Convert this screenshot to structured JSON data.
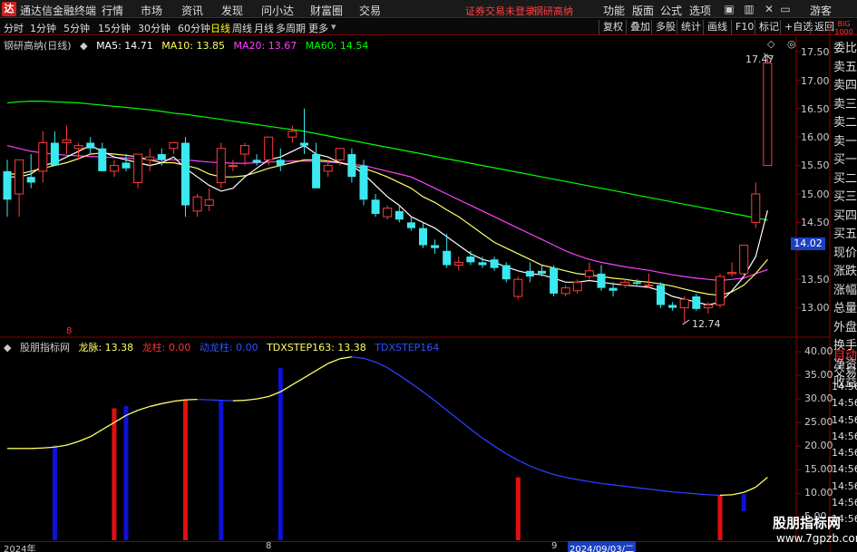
{
  "app": {
    "logo_char": "达",
    "title": "通达信金融终端",
    "menus": [
      "行情",
      "市场",
      "资讯",
      "发现",
      "问小达",
      "财富圈",
      "交易"
    ],
    "notice_login": "证券交易未登录",
    "notice_stock": "钢研高纳",
    "right_menus": [
      "功能",
      "版面",
      "公式",
      "选项"
    ],
    "guest": "游客"
  },
  "periods": {
    "items": [
      "分时",
      "1分钟",
      "5分钟",
      "15分钟",
      "30分钟",
      "60分钟",
      "日线",
      "周线",
      "月线",
      "多周期",
      "更多"
    ],
    "active_index": 6,
    "tools": [
      "复权",
      "叠加",
      "多股",
      "统计",
      "画线",
      "F10",
      "标记",
      "+自选",
      "返回"
    ]
  },
  "main_chart": {
    "stock_title": "钢研高纳(日线)",
    "ma5_label": "MA5: 14.71",
    "ma10_label": "MA10: 13.85",
    "ma20_label": "MA20: 13.67",
    "ma60_label": "MA60: 14.54",
    "high_label": "17.47",
    "low_label": "12.74",
    "current_price": "14.02",
    "y_ticks": [
      "17.50",
      "17.00",
      "16.50",
      "16.00",
      "15.50",
      "15.00",
      "14.50",
      "14.00",
      "13.50",
      "13.00"
    ],
    "colors": {
      "up": "#ff3c3c",
      "down": "#3ce8f0",
      "ma5": "#ffffff",
      "ma10": "#ffff66",
      "ma20": "#ff40ff",
      "ma60": "#00ff00"
    }
  },
  "indicator": {
    "name": "股朋指标网",
    "longmai_label": "龙脉: 13.38",
    "longzhu_label": "龙柱: 0.00",
    "dongzhu_label": "动龙柱: 0.00",
    "step163_label": "TDXSTEP163: 13.38",
    "step164_label": "TDXSTEP164",
    "marker": "8",
    "y_ticks": [
      "40.00",
      "35.00",
      "30.00",
      "25.00",
      "20.00",
      "15.00",
      "10.00",
      "5.00"
    ]
  },
  "right_panel": {
    "top_label": "BIG",
    "top_sub": "1000",
    "items": [
      "委比",
      "卖五",
      "卖四",
      "卖三",
      "卖二",
      "卖一",
      "买一",
      "买二",
      "买三",
      "买四",
      "买五",
      "现价",
      "涨跌",
      "涨幅",
      "总量",
      "外盘",
      "换手",
      "净资",
      "收益"
    ],
    "lower_items": [
      "自动",
      "交易"
    ],
    "times": [
      "14:56",
      "14:56",
      "14:56",
      "14:56",
      "14:56",
      "14:56",
      "14:56",
      "14:56",
      "14:56"
    ]
  },
  "bottom": {
    "year_label": "2024年",
    "month8": "8",
    "month9": "9",
    "date_label": "2024/09/03/二"
  },
  "watermark": {
    "line1": "股朋指标网",
    "line2": "www.7gpzb.com"
  },
  "chart_data": [
    {
      "type": "candlestick",
      "title": "钢研高纳(日线)",
      "ylim": [
        12.6,
        17.7
      ],
      "candles": [
        {
          "o": 15.4,
          "h": 15.6,
          "l": 14.6,
          "c": 14.9
        },
        {
          "o": 15.0,
          "h": 15.6,
          "l": 14.6,
          "c": 15.6
        },
        {
          "o": 15.3,
          "h": 15.7,
          "l": 15.1,
          "c": 15.2
        },
        {
          "o": 15.4,
          "h": 16.1,
          "l": 15.2,
          "c": 15.9
        },
        {
          "o": 15.9,
          "h": 16.1,
          "l": 15.6,
          "c": 15.5
        },
        {
          "o": 15.9,
          "h": 16.2,
          "l": 15.7,
          "c": 15.95
        },
        {
          "o": 15.8,
          "h": 15.9,
          "l": 15.6,
          "c": 15.85
        },
        {
          "o": 15.9,
          "h": 16.0,
          "l": 15.7,
          "c": 15.8
        },
        {
          "o": 15.8,
          "h": 15.9,
          "l": 15.4,
          "c": 15.4
        },
        {
          "o": 15.4,
          "h": 15.6,
          "l": 15.3,
          "c": 15.5
        },
        {
          "o": 15.55,
          "h": 15.7,
          "l": 15.4,
          "c": 15.45
        },
        {
          "o": 15.2,
          "h": 15.7,
          "l": 15.1,
          "c": 15.7
        },
        {
          "o": 15.6,
          "h": 15.8,
          "l": 15.4,
          "c": 15.65
        },
        {
          "o": 15.7,
          "h": 15.8,
          "l": 15.5,
          "c": 15.6
        },
        {
          "o": 15.8,
          "h": 15.9,
          "l": 15.7,
          "c": 15.9
        },
        {
          "o": 15.9,
          "h": 16.0,
          "l": 14.6,
          "c": 14.8
        },
        {
          "o": 14.7,
          "h": 15.0,
          "l": 14.6,
          "c": 14.95
        },
        {
          "o": 14.8,
          "h": 15.1,
          "l": 14.7,
          "c": 14.9
        },
        {
          "o": 15.2,
          "h": 15.9,
          "l": 15.1,
          "c": 15.8
        },
        {
          "o": 15.5,
          "h": 15.6,
          "l": 15.4,
          "c": 15.5
        },
        {
          "o": 15.7,
          "h": 15.9,
          "l": 15.5,
          "c": 15.85
        },
        {
          "o": 15.6,
          "h": 15.7,
          "l": 15.5,
          "c": 15.55
        },
        {
          "o": 15.6,
          "h": 16.0,
          "l": 15.5,
          "c": 16.0
        },
        {
          "o": 15.6,
          "h": 15.8,
          "l": 15.4,
          "c": 15.5
        },
        {
          "o": 16.0,
          "h": 16.2,
          "l": 15.9,
          "c": 16.1
        },
        {
          "o": 15.9,
          "h": 16.5,
          "l": 15.7,
          "c": 15.85
        },
        {
          "o": 15.7,
          "h": 15.9,
          "l": 15.1,
          "c": 15.1
        },
        {
          "o": 15.4,
          "h": 15.6,
          "l": 15.3,
          "c": 15.5
        },
        {
          "o": 15.6,
          "h": 15.8,
          "l": 15.5,
          "c": 15.8
        },
        {
          "o": 15.7,
          "h": 15.8,
          "l": 15.2,
          "c": 15.3
        },
        {
          "o": 15.5,
          "h": 15.6,
          "l": 14.8,
          "c": 14.9
        },
        {
          "o": 14.9,
          "h": 15.0,
          "l": 14.6,
          "c": 14.65
        },
        {
          "o": 14.6,
          "h": 14.8,
          "l": 14.55,
          "c": 14.75
        },
        {
          "o": 14.7,
          "h": 14.8,
          "l": 14.5,
          "c": 14.55
        },
        {
          "o": 14.5,
          "h": 14.6,
          "l": 14.35,
          "c": 14.4
        },
        {
          "o": 14.4,
          "h": 14.5,
          "l": 14.05,
          "c": 14.1
        },
        {
          "o": 14.1,
          "h": 14.2,
          "l": 13.95,
          "c": 14.05
        },
        {
          "o": 14.0,
          "h": 14.3,
          "l": 13.7,
          "c": 13.75
        },
        {
          "o": 13.75,
          "h": 13.9,
          "l": 13.65,
          "c": 13.8
        },
        {
          "o": 13.9,
          "h": 14.0,
          "l": 13.75,
          "c": 13.8
        },
        {
          "o": 13.8,
          "h": 13.9,
          "l": 13.7,
          "c": 13.75
        },
        {
          "o": 13.85,
          "h": 13.9,
          "l": 13.65,
          "c": 13.7
        },
        {
          "o": 13.75,
          "h": 13.8,
          "l": 13.45,
          "c": 13.5
        },
        {
          "o": 13.2,
          "h": 13.55,
          "l": 13.15,
          "c": 13.5
        },
        {
          "o": 13.65,
          "h": 13.8,
          "l": 13.45,
          "c": 13.55
        },
        {
          "o": 13.65,
          "h": 13.75,
          "l": 13.55,
          "c": 13.6
        },
        {
          "o": 13.7,
          "h": 13.75,
          "l": 13.2,
          "c": 13.25
        },
        {
          "o": 13.25,
          "h": 13.4,
          "l": 13.2,
          "c": 13.35
        },
        {
          "o": 13.3,
          "h": 13.5,
          "l": 13.25,
          "c": 13.45
        },
        {
          "o": 13.55,
          "h": 13.8,
          "l": 13.5,
          "c": 13.65
        },
        {
          "o": 13.6,
          "h": 13.75,
          "l": 13.3,
          "c": 13.35
        },
        {
          "o": 13.35,
          "h": 13.45,
          "l": 13.2,
          "c": 13.3
        },
        {
          "o": 13.4,
          "h": 13.5,
          "l": 13.35,
          "c": 13.45
        },
        {
          "o": 13.45,
          "h": 13.5,
          "l": 13.4,
          "c": 13.42
        },
        {
          "o": 13.4,
          "h": 13.6,
          "l": 13.35,
          "c": 13.4
        },
        {
          "o": 13.4,
          "h": 13.45,
          "l": 13.0,
          "c": 13.05
        },
        {
          "o": 13.05,
          "h": 13.1,
          "l": 12.95,
          "c": 13.0
        },
        {
          "o": 13.0,
          "h": 13.2,
          "l": 12.74,
          "c": 13.15
        },
        {
          "o": 13.2,
          "h": 13.25,
          "l": 12.95,
          "c": 12.98
        },
        {
          "o": 13.0,
          "h": 13.1,
          "l": 12.9,
          "c": 13.05
        },
        {
          "o": 13.05,
          "h": 13.6,
          "l": 13.0,
          "c": 13.55
        },
        {
          "o": 13.6,
          "h": 13.8,
          "l": 13.55,
          "c": 13.62
        },
        {
          "o": 13.6,
          "h": 14.1,
          "l": 13.55,
          "c": 14.1
        },
        {
          "o": 14.5,
          "h": 15.2,
          "l": 14.4,
          "c": 15.0
        },
        {
          "o": 15.5,
          "h": 17.47,
          "l": 15.5,
          "c": 17.3
        }
      ],
      "ma5": [
        15.3,
        15.3,
        15.35,
        15.5,
        15.55,
        15.65,
        15.75,
        15.85,
        15.75,
        15.65,
        15.6,
        15.55,
        15.5,
        15.55,
        15.65,
        15.45,
        15.3,
        15.15,
        15.05,
        15.1,
        15.3,
        15.45,
        15.6,
        15.65,
        15.75,
        15.85,
        15.7,
        15.65,
        15.55,
        15.5,
        15.35,
        15.15,
        14.95,
        14.8,
        14.6,
        14.5,
        14.4,
        14.25,
        14.1,
        13.95,
        13.85,
        13.8,
        13.72,
        13.65,
        13.6,
        13.58,
        13.52,
        13.45,
        13.45,
        13.48,
        13.45,
        13.42,
        13.4,
        13.38,
        13.36,
        13.3,
        13.2,
        13.15,
        13.1,
        13.05,
        13.1,
        13.3,
        13.55,
        13.9,
        14.71
      ],
      "ma10": [
        15.35,
        15.35,
        15.4,
        15.45,
        15.5,
        15.55,
        15.62,
        15.7,
        15.72,
        15.7,
        15.68,
        15.65,
        15.6,
        15.55,
        15.55,
        15.5,
        15.45,
        15.35,
        15.3,
        15.3,
        15.32,
        15.38,
        15.45,
        15.5,
        15.55,
        15.6,
        15.6,
        15.58,
        15.55,
        15.5,
        15.45,
        15.38,
        15.3,
        15.2,
        15.1,
        14.95,
        14.85,
        14.72,
        14.6,
        14.45,
        14.3,
        14.15,
        14.05,
        13.95,
        13.85,
        13.75,
        13.7,
        13.65,
        13.6,
        13.58,
        13.55,
        13.52,
        13.5,
        13.47,
        13.45,
        13.42,
        13.38,
        13.33,
        13.28,
        13.24,
        13.22,
        13.28,
        13.4,
        13.6,
        13.85
      ],
      "ma20": [
        15.85,
        15.8,
        15.75,
        15.72,
        15.7,
        15.68,
        15.67,
        15.66,
        15.65,
        15.64,
        15.63,
        15.62,
        15.61,
        15.6,
        15.6,
        15.6,
        15.58,
        15.56,
        15.55,
        15.54,
        15.54,
        15.55,
        15.56,
        15.57,
        15.58,
        15.58,
        15.57,
        15.56,
        15.55,
        15.52,
        15.5,
        15.45,
        15.4,
        15.35,
        15.3,
        15.2,
        15.1,
        15.0,
        14.9,
        14.8,
        14.7,
        14.6,
        14.5,
        14.4,
        14.3,
        14.2,
        14.1,
        14.0,
        13.92,
        13.85,
        13.8,
        13.76,
        13.72,
        13.69,
        13.66,
        13.62,
        13.58,
        13.55,
        13.52,
        13.5,
        13.48,
        13.5,
        13.52,
        13.6,
        13.67
      ],
      "ma60": [
        16.6,
        16.62,
        16.63,
        16.63,
        16.62,
        16.61,
        16.6,
        16.58,
        16.56,
        16.54,
        16.52,
        16.5,
        16.48,
        16.45,
        16.42,
        16.4,
        16.37,
        16.34,
        16.31,
        16.28,
        16.25,
        16.22,
        16.19,
        16.16,
        16.13,
        16.1,
        16.06,
        16.02,
        15.98,
        15.94,
        15.9,
        15.86,
        15.82,
        15.78,
        15.74,
        15.7,
        15.66,
        15.62,
        15.58,
        15.54,
        15.5,
        15.46,
        15.42,
        15.38,
        15.34,
        15.3,
        15.26,
        15.22,
        15.18,
        15.14,
        15.1,
        15.06,
        15.02,
        14.98,
        14.94,
        14.9,
        14.86,
        14.82,
        14.78,
        14.74,
        14.7,
        14.66,
        14.62,
        14.58,
        14.54
      ]
    },
    {
      "type": "line",
      "title": "股朋指标网",
      "ylim": [
        0,
        42
      ],
      "longmai": [
        19.5,
        19.5,
        19.5,
        19.6,
        19.8,
        20.2,
        21.0,
        22.0,
        23.5,
        25.0,
        26.5,
        27.6,
        28.4,
        29.0,
        29.5,
        29.8,
        29.9,
        29.8,
        29.7,
        29.6,
        29.7,
        30.0,
        30.5,
        31.5,
        33.0,
        34.5,
        36.0,
        37.5,
        38.5,
        38.9,
        38.6,
        37.8,
        36.6,
        35.0,
        33.3,
        31.5,
        29.6,
        27.6,
        25.6,
        23.6,
        21.7,
        20.0,
        18.4,
        17.0,
        15.8,
        14.8,
        14.0,
        13.4,
        12.9,
        12.5,
        12.1,
        11.8,
        11.5,
        11.2,
        10.9,
        10.6,
        10.3,
        10.1,
        9.9,
        9.7,
        9.6,
        9.7,
        10.2,
        11.3,
        13.4
      ],
      "red_bars": [
        {
          "i": 9,
          "top": 28.0
        },
        {
          "i": 15,
          "top": 29.8
        },
        {
          "i": 43,
          "top": 13.4
        },
        {
          "i": 60,
          "top": 9.7
        }
      ],
      "blue_bars": [
        {
          "i": 4,
          "top": 20.2
        },
        {
          "i": 10,
          "top": 28.5
        },
        {
          "i": 18,
          "top": 29.7
        },
        {
          "i": 23,
          "top": 36.5
        },
        {
          "i": 62,
          "top": 9.8,
          "bottom": 6.2
        }
      ]
    }
  ]
}
